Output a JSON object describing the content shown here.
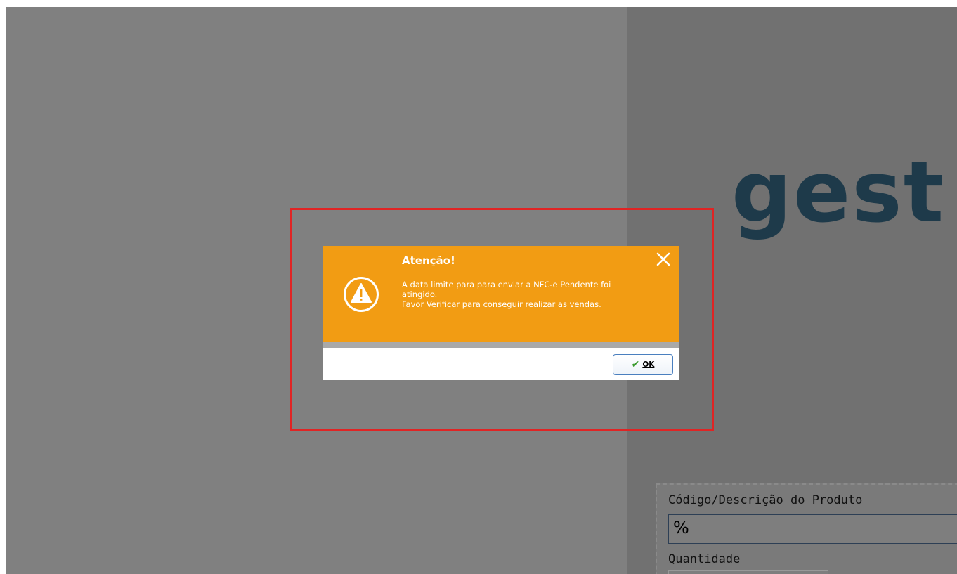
{
  "background": {
    "brand_text": "gest",
    "product_panel": {
      "code_label": "Código/Descrição do Produto",
      "code_value": "%",
      "quantity_label": "Quantidade"
    }
  },
  "dialog": {
    "title": "Atenção!",
    "message_lines": [
      "A data limite para para enviar a NFC-e Pendente foi",
      "atingido.",
      "Favor Verificar para conseguir realizar as vendas."
    ],
    "ok_label": "OK",
    "icons": {
      "warning": "warning-icon",
      "close": "close-icon",
      "ok": "checkmark-icon"
    },
    "colors": {
      "header": "#f29c13",
      "highlight": "#e02424",
      "brand": "#1e3a4a"
    }
  }
}
